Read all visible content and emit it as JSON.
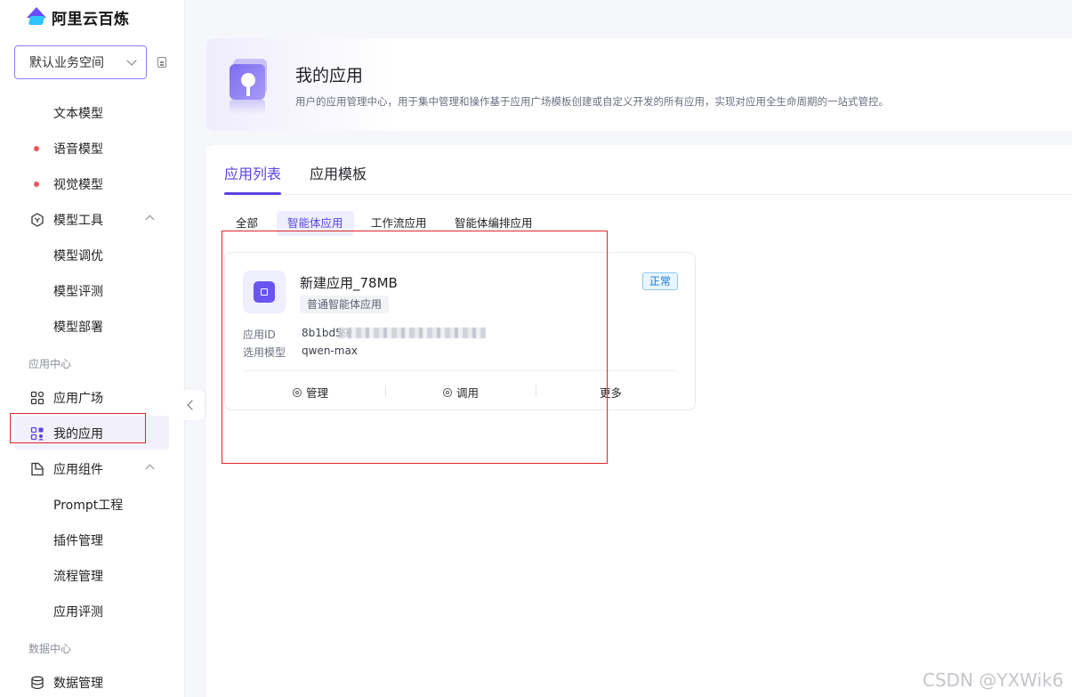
{
  "brand": {
    "name": "阿里云百炼"
  },
  "workspace": {
    "selected": "默认业务空间"
  },
  "sidebar": {
    "items": [
      {
        "label": "文本模型"
      },
      {
        "label": "语音模型"
      },
      {
        "label": "视觉模型"
      },
      {
        "label": "模型工具"
      },
      {
        "label": "模型调优"
      },
      {
        "label": "模型评测"
      },
      {
        "label": "模型部署"
      },
      {
        "label": "应用广场"
      },
      {
        "label": "我的应用"
      },
      {
        "label": "应用组件"
      },
      {
        "label": "Prompt工程"
      },
      {
        "label": "插件管理"
      },
      {
        "label": "流程管理"
      },
      {
        "label": "应用评测"
      },
      {
        "label": "数据管理"
      }
    ],
    "sections": {
      "apps": "应用中心",
      "data": "数据中心"
    }
  },
  "header": {
    "title": "我的应用",
    "description": "用户的应用管理中心，用于集中管理和操作基于应用广场模板创建或自定义开发的所有应用，实现对应用全生命周期的一站式管控。"
  },
  "tabs": [
    {
      "label": "应用列表"
    },
    {
      "label": "应用模板"
    }
  ],
  "filters": [
    {
      "label": "全部"
    },
    {
      "label": "智能体应用"
    },
    {
      "label": "工作流应用"
    },
    {
      "label": "智能体编排应用"
    }
  ],
  "app_card": {
    "name": "新建应用_78MB",
    "type": "普通智能体应用",
    "status": "正常",
    "id_label": "应用ID",
    "id_value": "8b1bd59",
    "model_label": "选用模型",
    "model_value": "qwen-max",
    "actions": {
      "manage": "管理",
      "invoke": "调用",
      "more": "更多"
    }
  },
  "watermark": "CSDN @YXWik6",
  "colors": {
    "accent": "#5a44e0",
    "status": "#1677d4",
    "highlight": "#e0242b"
  }
}
